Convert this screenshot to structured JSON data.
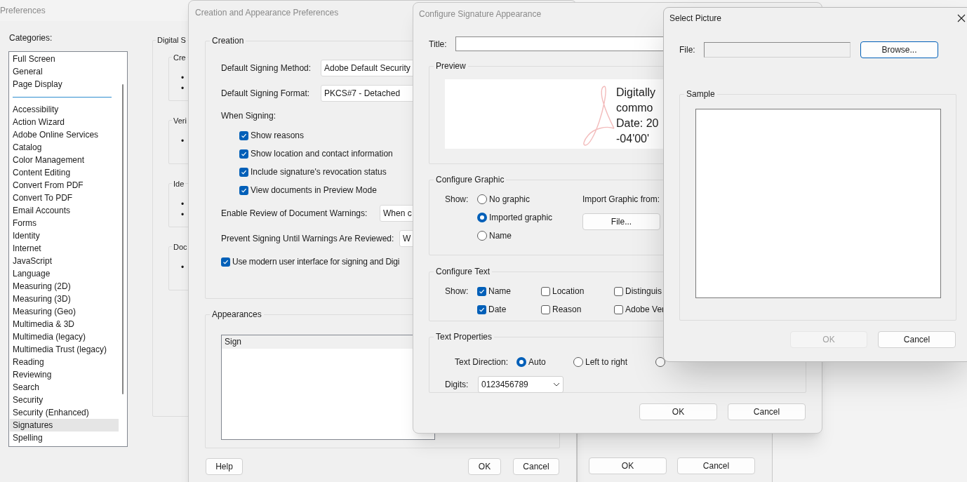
{
  "preferences": {
    "title": "Preferences",
    "categories_label": "Categories:",
    "pinned_categories": [
      {
        "label": "Full Screen",
        "selected": false
      },
      {
        "label": "General",
        "selected": false
      },
      {
        "label": "Page Display",
        "selected": false
      }
    ],
    "categories": [
      {
        "label": "Accessibility",
        "selected": false
      },
      {
        "label": "Action Wizard",
        "selected": false
      },
      {
        "label": "Adobe Online Services",
        "selected": false
      },
      {
        "label": "Catalog",
        "selected": false
      },
      {
        "label": "Color Management",
        "selected": false
      },
      {
        "label": "Content Editing",
        "selected": false
      },
      {
        "label": "Convert From PDF",
        "selected": false
      },
      {
        "label": "Convert To PDF",
        "selected": false
      },
      {
        "label": "Email Accounts",
        "selected": false
      },
      {
        "label": "Forms",
        "selected": false
      },
      {
        "label": "Identity",
        "selected": false
      },
      {
        "label": "Internet",
        "selected": false
      },
      {
        "label": "JavaScript",
        "selected": false
      },
      {
        "label": "Language",
        "selected": false
      },
      {
        "label": "Measuring (2D)",
        "selected": false
      },
      {
        "label": "Measuring (3D)",
        "selected": false
      },
      {
        "label": "Measuring (Geo)",
        "selected": false
      },
      {
        "label": "Multimedia & 3D",
        "selected": false
      },
      {
        "label": "Multimedia (legacy)",
        "selected": false
      },
      {
        "label": "Multimedia Trust (legacy)",
        "selected": false
      },
      {
        "label": "Reading",
        "selected": false
      },
      {
        "label": "Reviewing",
        "selected": false
      },
      {
        "label": "Search",
        "selected": false
      },
      {
        "label": "Security",
        "selected": false
      },
      {
        "label": "Security (Enhanced)",
        "selected": false
      },
      {
        "label": "Signatures",
        "selected": true
      },
      {
        "label": "Spelling",
        "selected": false
      }
    ],
    "group": {
      "title": "Digital S",
      "sections": [
        {
          "title": "Cre",
          "bullets": [
            "•",
            "•"
          ]
        },
        {
          "title": "Veri",
          "bullets": [
            "•"
          ]
        },
        {
          "title": "Ide",
          "bullets": [
            "•",
            "•"
          ]
        },
        {
          "title": "Doc",
          "bullets": [
            "•"
          ]
        }
      ]
    }
  },
  "creation_window": {
    "title": "Creation and Appearance Preferences",
    "creation": {
      "title": "Creation",
      "fields": [
        {
          "label": "Default Signing Method:",
          "value": "Adobe Default Security"
        },
        {
          "label": "Default Signing Format:",
          "value": "PKCS#7 - Detached"
        }
      ],
      "when_signing_label": "When Signing:",
      "options": [
        {
          "label": "Show reasons",
          "checked": true
        },
        {
          "label": "Show location and contact information",
          "checked": true
        },
        {
          "label": "Include signature's revocation status",
          "checked": true
        },
        {
          "label": "View documents in Preview Mode",
          "checked": true
        }
      ],
      "warning_fields": [
        {
          "label": "Enable Review of Document Warnings:",
          "value": "When c"
        },
        {
          "label": "Prevent Signing Until Warnings Are Reviewed:",
          "value": "W"
        }
      ],
      "modern_ui": {
        "label": "Use modern user interface for signing and Digi",
        "checked": true
      }
    },
    "appearances": {
      "title": "Appearances",
      "items": [
        {
          "label": "Sign",
          "selected": true
        }
      ]
    },
    "buttons": {
      "help": "Help",
      "ok": "OK",
      "cancel": "Cancel"
    }
  },
  "background_window": {
    "buttons": {
      "ok": "OK",
      "cancel": "Cancel"
    }
  },
  "configure_window": {
    "title": "Configure Signature Appearance",
    "title_label": "Title:",
    "preview": {
      "title": "Preview",
      "lines": [
        "Digitally",
        "commo",
        "Date: 20",
        "-04'00'"
      ]
    },
    "graphic": {
      "title": "Configure Graphic",
      "show_label": "Show:",
      "options": [
        {
          "label": "No graphic",
          "selected": false
        },
        {
          "label": "Imported graphic",
          "selected": true
        },
        {
          "label": "Name",
          "selected": false
        }
      ],
      "import_label": "Import Graphic from:",
      "file_button": "File..."
    },
    "text": {
      "title": "Configure Text",
      "show_label": "Show:",
      "options": [
        {
          "label": "Name",
          "checked": true
        },
        {
          "label": "Location",
          "checked": false
        },
        {
          "label": "Distinguis",
          "checked": false
        },
        {
          "label": "Date",
          "checked": true
        },
        {
          "label": "Reason",
          "checked": false
        },
        {
          "label": "Adobe Ver",
          "checked": false
        }
      ]
    },
    "text_properties": {
      "title": "Text Properties",
      "direction_label": "Text Direction:",
      "directions": [
        {
          "label": "Auto",
          "selected": true
        },
        {
          "label": "Left to right",
          "selected": false
        },
        {
          "selected": false
        }
      ],
      "digits_label": "Digits:",
      "digits_value": "0123456789"
    },
    "buttons": {
      "ok": "OK",
      "cancel": "Cancel"
    }
  },
  "select_picture": {
    "title": "Select Picture",
    "file_label": "File:",
    "browse_button": "Browse...",
    "sample_title": "Sample",
    "ok": {
      "label": "OK",
      "disabled": true
    },
    "cancel": "Cancel"
  }
}
